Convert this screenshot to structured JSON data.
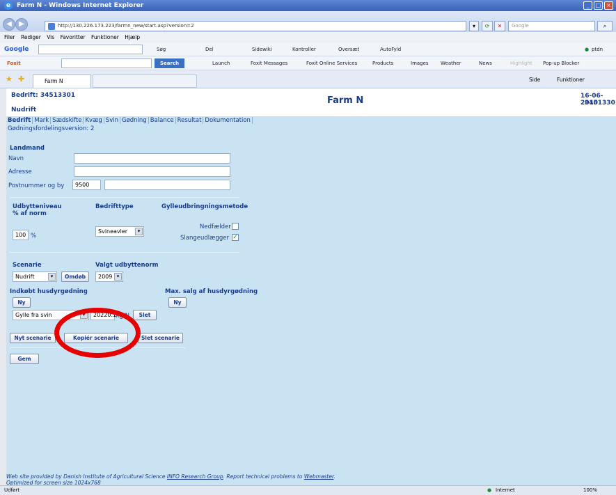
{
  "window": {
    "title": "Farm N - Windows Internet Explorer",
    "min": "_",
    "max": "□",
    "close": "×"
  },
  "address": {
    "url": "http://130.226.173.223/farmn_new/start.asp?version=2",
    "search_placeholder": "Google"
  },
  "menu": [
    "Filer",
    "Rediger",
    "Vis",
    "Favoritter",
    "Funktioner",
    "Hjælp"
  ],
  "googlebar": {
    "logo": "Google",
    "items": [
      "Søg",
      "Del",
      "Sidewiki",
      "Kontroller",
      "Oversæt",
      "AutoFyld"
    ],
    "user": "ptdn"
  },
  "foxitbar": {
    "logo": "Foxit",
    "search": "Search",
    "items": [
      "Launch",
      "Foxit Messages",
      "Foxit Online Services",
      "Products",
      "Images",
      "Weather",
      "News",
      "Highlight",
      "Pop-up Blocker"
    ]
  },
  "tabbar": {
    "tab_label": "Farm N",
    "right_items": [
      "Side",
      "Funktioner"
    ]
  },
  "page": {
    "bedrift_label": "Bedrift: 34513301",
    "title": "Farm N",
    "date": "16-06-2010",
    "id_right": "34513301",
    "nudrift": "Nudrift",
    "tabs": [
      "Bedrift",
      "Mark",
      "Sædskifte",
      "Kvæg",
      "Svin",
      "Gødning",
      "Balance",
      "Resultat",
      "Dokumentation"
    ],
    "version": "Gødningsfordelingsversion: 2",
    "landmand": "Landmand",
    "navn_label": "Navn",
    "adresse_label": "Adresse",
    "postnr_label": "Postnummer og by",
    "postnr_value": "9500",
    "udbytte_label": "Udbytteniveau",
    "udbytte_sub": "% af norm",
    "udbytte_value": "100",
    "pct": "%",
    "bedriftstype_label": "Bedrifttype",
    "bedriftstype_value": "Svineavler",
    "gylle_label": "Gylleudbringningsmetode",
    "nedfaelder": "Nedfælder",
    "slangeudlaegger": "Slangeudlægger",
    "scenarie_label": "Scenarie",
    "scenarie_value": "Nudrift",
    "omdob": "Omdøb",
    "valgt_label": "Valgt udbyttenorm",
    "valgt_value": "2009",
    "indkobt_label": "Indkøbt husdyrgødning",
    "ny1": "Ny",
    "maxsalg_label": "Max. salg af husdyrgødning",
    "ny2": "Ny",
    "gylle_value": "Gylle fra svin",
    "kg_value": "20220.1",
    "kg_unit": "Kg N",
    "slet": "Slet",
    "nyt_scenarie": "Nyt scenarie",
    "kopier": "Kopiér scenarie",
    "slet_scenarie": "Slet scenarie",
    "gem": "Gem",
    "footer1a": "Web site provided by Danish Institute of Agricultural Science ",
    "footer1b": "INFO Research Group",
    "footer1c": ". Report technical problems to ",
    "footer1d": "Webmaster",
    "footer1e": ".",
    "footer2": "Optimized for screen size 1024x768"
  },
  "status": {
    "left": "Udført",
    "zone": "Internet",
    "zoom": "100%"
  }
}
